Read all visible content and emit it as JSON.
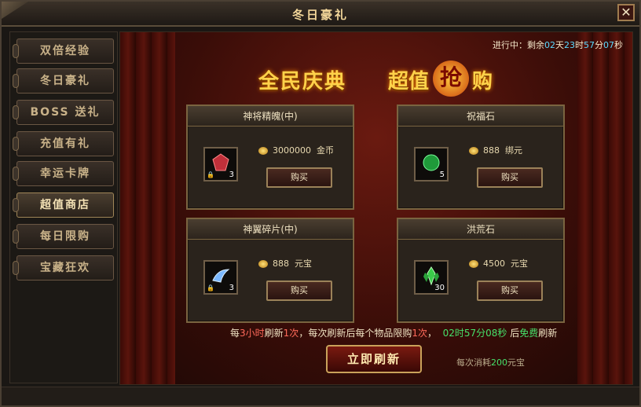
{
  "window": {
    "title": "冬日豪礼",
    "close_label": "✕"
  },
  "sidebar": {
    "tabs": [
      {
        "label": "双倍经验",
        "active": false
      },
      {
        "label": "冬日豪礼",
        "active": false
      },
      {
        "label": "BOSS 送礼",
        "active": false
      },
      {
        "label": "充值有礼",
        "active": false
      },
      {
        "label": "幸运卡牌",
        "active": false
      },
      {
        "label": "超值商店",
        "active": true
      },
      {
        "label": "每日限购",
        "active": false
      },
      {
        "label": "宝藏狂欢",
        "active": false
      }
    ]
  },
  "main": {
    "countdown": {
      "prefix": "进行中：剩余",
      "days": "02",
      "d_unit": "天",
      "hours": "23",
      "h_unit": "时",
      "minutes": "57",
      "m_unit": "分",
      "seconds": "07",
      "s_unit": "秒"
    },
    "banner": {
      "left": "全民庆典",
      "right_a": "超值",
      "right_b": "抢",
      "right_c": "购"
    },
    "items": [
      {
        "name": "神将精魄(中)",
        "qty": "3",
        "price": "3000000",
        "currency": "金币",
        "buy": "购买"
      },
      {
        "name": "祝福石",
        "qty": "5",
        "price": "888",
        "currency": "绑元",
        "buy": "购买"
      },
      {
        "name": "神翼碎片(中)",
        "qty": "3",
        "price": "888",
        "currency": "元宝",
        "buy": "购买"
      },
      {
        "name": "洪荒石",
        "qty": "30",
        "price": "4500",
        "currency": "元宝",
        "buy": "购买"
      }
    ],
    "refresh_note": {
      "p1": "每",
      "n1": "3小时",
      "p2": "刷新",
      "n2": "1次",
      "p3": "，每次刷新后每个物品限购",
      "n3": "1次",
      "p4": "，",
      "timer": "02时57分08秒",
      "p5": " 后",
      "free": "免费",
      "p6": "刷新"
    },
    "refresh_button": "立即刷新",
    "cost": {
      "prefix": "每次消耗",
      "amount": "200",
      "suffix": "元宝"
    }
  }
}
